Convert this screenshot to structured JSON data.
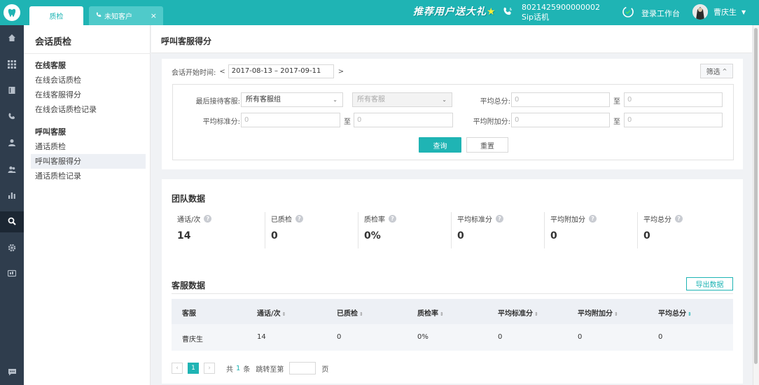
{
  "colors": {
    "accent": "#1fb4b4",
    "rail_bg": "#2f3d4d",
    "rail_active": "#1c2733",
    "page_bg": "#f0f2f5"
  },
  "topbar": {
    "tabs": [
      {
        "label": "质检",
        "active": true
      },
      {
        "label": "未知客户",
        "icon": "phone-icon",
        "closable": true
      }
    ],
    "promo_text": "推荐用户送大礼",
    "phone_number": "8021425900000002",
    "phone_type": "Sip话机",
    "workbench_label": "登录工作台",
    "user_name": "曹庆生"
  },
  "rail": {
    "items": [
      "home-icon",
      "grid-icon",
      "book-icon",
      "phone-icon",
      "user-icon",
      "users-icon",
      "chart-icon",
      "search-icon",
      "gear-icon",
      "monitor-icon"
    ],
    "active_index": 7,
    "bottom_icon": "chat-icon"
  },
  "subnav": {
    "title": "会话质检",
    "groups": [
      {
        "title": "在线客服",
        "items": [
          "在线会话质检",
          "在线客服得分",
          "在线会话质检记录"
        ]
      },
      {
        "title": "呼叫客服",
        "items": [
          "通话质检",
          "呼叫客服得分",
          "通话质检记录"
        ]
      }
    ],
    "active_item": "呼叫客服得分"
  },
  "page": {
    "title": "呼叫客服得分"
  },
  "filter": {
    "date_label": "会话开始时间:",
    "date_prev": "<",
    "date_range": "2017-08-13 – 2017-09-11",
    "date_next": ">",
    "toggle_label": "筛选",
    "last_agent_label": "最后接待客服:",
    "agent_group_value": "所有客服组",
    "agent_value": "所有客服",
    "avg_total_label": "平均总分:",
    "avg_standard_label": "平均标准分:",
    "avg_bonus_label": "平均附加分:",
    "to_label": "至",
    "min_placeholder": "0",
    "max_placeholder": "0",
    "query_label": "查询",
    "reset_label": "重置"
  },
  "team": {
    "title": "团队数据",
    "stats": [
      {
        "label": "通话/次",
        "value": "14"
      },
      {
        "label": "已质检",
        "value": "0"
      },
      {
        "label": "质检率",
        "value": "0%"
      },
      {
        "label": "平均标准分",
        "value": "0"
      },
      {
        "label": "平均附加分",
        "value": "0"
      },
      {
        "label": "平均总分",
        "value": "0"
      }
    ]
  },
  "agents": {
    "title": "客服数据",
    "export_label": "导出数据",
    "columns": [
      "客服",
      "通话/次",
      "已质检",
      "质检率",
      "平均标准分",
      "平均附加分",
      "平均总分"
    ],
    "rows": [
      [
        "曹庆生",
        "14",
        "0",
        "0%",
        "0",
        "0",
        "0"
      ]
    ]
  },
  "pagination": {
    "prev": "‹",
    "current_page": "1",
    "next": "›",
    "total_prefix": "共",
    "total_count": "1",
    "total_suffix": "条",
    "jump_label": "跳转至第",
    "page_suffix": "页"
  }
}
